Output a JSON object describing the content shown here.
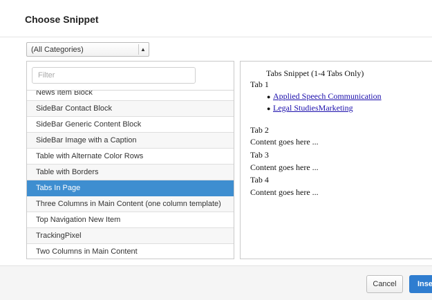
{
  "dialog": {
    "title": "Choose Snippet"
  },
  "category": {
    "selected": "(All Categories)",
    "arrow_icon": "select-arrows-icon"
  },
  "filter": {
    "placeholder": "Filter",
    "value": ""
  },
  "snippets": [
    {
      "label": "News Item Block",
      "selected": false
    },
    {
      "label": "SideBar Contact Block",
      "selected": false
    },
    {
      "label": "SideBar Generic Content Block",
      "selected": false
    },
    {
      "label": "SideBar Image with a Caption",
      "selected": false
    },
    {
      "label": "Table with Alternate Color Rows",
      "selected": false
    },
    {
      "label": "Table with Borders",
      "selected": false
    },
    {
      "label": "Tabs In Page",
      "selected": true
    },
    {
      "label": "Three Columns in Main Content (one column template)",
      "selected": false
    },
    {
      "label": "Top Navigation New Item",
      "selected": false
    },
    {
      "label": "TrackingPixel",
      "selected": false
    },
    {
      "label": "Two Columns in Main Content",
      "selected": false
    }
  ],
  "preview": {
    "heading": "Tabs Snippet (1-4 Tabs Only)",
    "tab1": "Tab 1",
    "link1": "Applied Speech Communication",
    "link2": "Legal StudiesMarketing",
    "tab2": "Tab 2",
    "content2": "Content goes here ...",
    "tab3": "Tab 3",
    "content3": "Content goes here ...",
    "tab4": "Tab 4",
    "content4": "Content goes here ..."
  },
  "footer": {
    "cancel": "Cancel",
    "insert": "Insert"
  },
  "colors": {
    "selection": "#3e8ed0",
    "insert_button": "#2f7dd0",
    "link": "#1a0dab"
  }
}
